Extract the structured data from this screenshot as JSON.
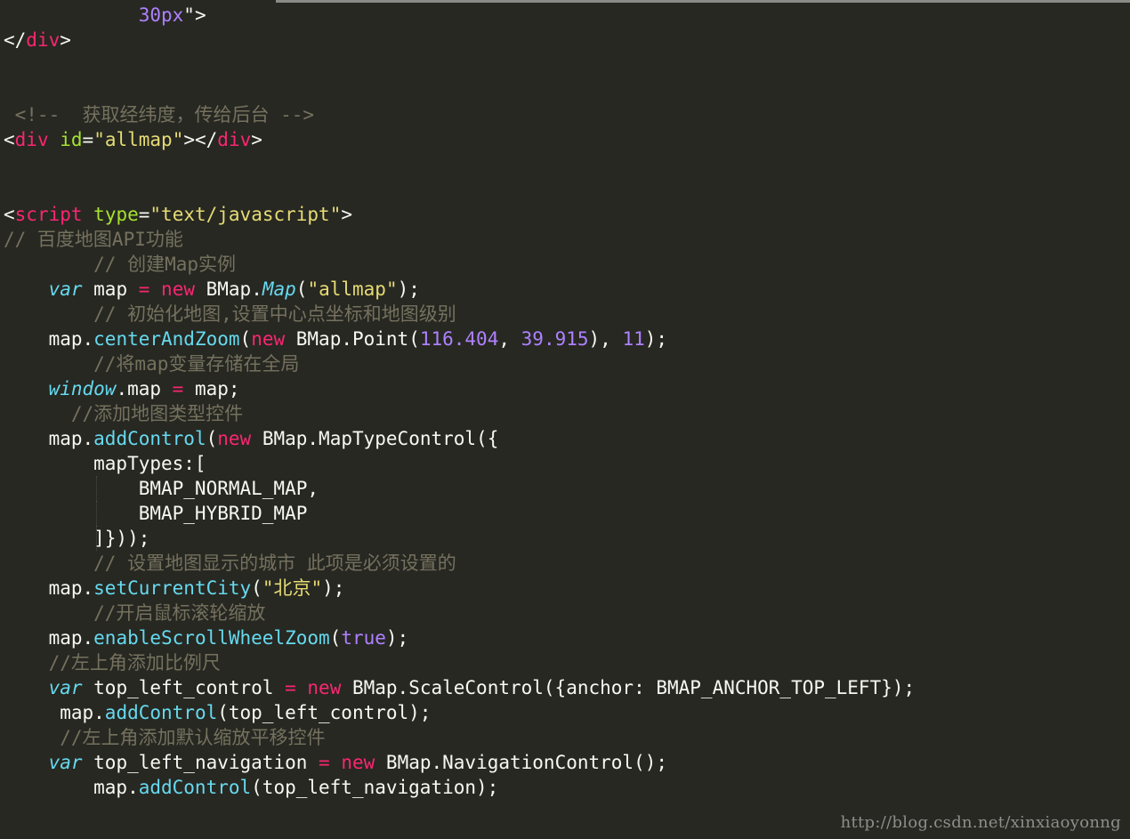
{
  "window": {
    "title": ""
  },
  "colors": {
    "background": "#272822",
    "tag": "#f92672",
    "attribute": "#a6e22e",
    "string": "#e6db74",
    "number": "#ae81ff",
    "type": "#66d9ef",
    "comment": "#75715e",
    "text": "#f8f8f2"
  },
  "editor": {
    "lines": [
      [
        {
          "t": "plain",
          "v": "            "
        },
        {
          "t": "num",
          "v": "30px"
        },
        {
          "t": "plain",
          "v": "\">"
        }
      ],
      [
        {
          "t": "plain",
          "v": "</"
        },
        {
          "t": "tag",
          "v": "div"
        },
        {
          "t": "plain",
          "v": ">"
        }
      ],
      [],
      [],
      [
        {
          "t": "com",
          "v": " <!--  获取经纬度，传给后台 -->"
        }
      ],
      [
        {
          "t": "plain",
          "v": "<"
        },
        {
          "t": "tag",
          "v": "div"
        },
        {
          "t": "plain",
          "v": " "
        },
        {
          "t": "attr",
          "v": "id"
        },
        {
          "t": "plain",
          "v": "="
        },
        {
          "t": "str",
          "v": "\"allmap\""
        },
        {
          "t": "plain",
          "v": "></"
        },
        {
          "t": "tag",
          "v": "div"
        },
        {
          "t": "plain",
          "v": ">"
        }
      ],
      [],
      [],
      [
        {
          "t": "plain",
          "v": "<"
        },
        {
          "t": "tag",
          "v": "script"
        },
        {
          "t": "plain",
          "v": " "
        },
        {
          "t": "attr",
          "v": "type"
        },
        {
          "t": "plain",
          "v": "="
        },
        {
          "t": "str",
          "v": "\"text/javascript\""
        },
        {
          "t": "plain",
          "v": ">"
        }
      ],
      [
        {
          "t": "com",
          "v": "// 百度地图API功能"
        }
      ],
      [
        {
          "t": "com",
          "v": "        // 创建Map实例"
        }
      ],
      [
        {
          "t": "plain",
          "v": "    "
        },
        {
          "t": "type",
          "v": "var"
        },
        {
          "t": "plain",
          "v": " map "
        },
        {
          "t": "kw",
          "v": "="
        },
        {
          "t": "plain",
          "v": " "
        },
        {
          "t": "kw",
          "v": "new"
        },
        {
          "t": "plain",
          "v": " BMap."
        },
        {
          "t": "type",
          "v": "Map"
        },
        {
          "t": "plain",
          "v": "("
        },
        {
          "t": "str",
          "v": "\"allmap\""
        },
        {
          "t": "plain",
          "v": ");"
        }
      ],
      [
        {
          "t": "com",
          "v": "        // 初始化地图,设置中心点坐标和地图级别"
        }
      ],
      [
        {
          "t": "plain",
          "v": "    map."
        },
        {
          "t": "fn",
          "v": "centerAndZoom"
        },
        {
          "t": "plain",
          "v": "("
        },
        {
          "t": "kw",
          "v": "new"
        },
        {
          "t": "plain",
          "v": " BMap.Point("
        },
        {
          "t": "num",
          "v": "116.404"
        },
        {
          "t": "plain",
          "v": ", "
        },
        {
          "t": "num",
          "v": "39.915"
        },
        {
          "t": "plain",
          "v": "), "
        },
        {
          "t": "num",
          "v": "11"
        },
        {
          "t": "plain",
          "v": ");"
        }
      ],
      [
        {
          "t": "com",
          "v": "        //将map变量存储在全局"
        }
      ],
      [
        {
          "t": "plain",
          "v": "    "
        },
        {
          "t": "type",
          "v": "window"
        },
        {
          "t": "plain",
          "v": ".map "
        },
        {
          "t": "kw",
          "v": "="
        },
        {
          "t": "plain",
          "v": " map;"
        }
      ],
      [
        {
          "t": "com",
          "v": "      //添加地图类型控件"
        }
      ],
      [
        {
          "t": "plain",
          "v": "    map."
        },
        {
          "t": "fn",
          "v": "addControl"
        },
        {
          "t": "plain",
          "v": "("
        },
        {
          "t": "kw",
          "v": "new"
        },
        {
          "t": "plain",
          "v": " BMap.MapTypeControl({"
        }
      ],
      [
        {
          "t": "plain",
          "v": "        mapTypes:["
        }
      ],
      [
        {
          "t": "plain",
          "v": "            BMAP_NORMAL_MAP,"
        }
      ],
      [
        {
          "t": "plain",
          "v": "            BMAP_HYBRID_MAP"
        }
      ],
      [
        {
          "t": "plain",
          "v": "        ]}));"
        }
      ],
      [
        {
          "t": "com",
          "v": "        // 设置地图显示的城市 此项是必须设置的"
        }
      ],
      [
        {
          "t": "plain",
          "v": "    map."
        },
        {
          "t": "fn",
          "v": "setCurrentCity"
        },
        {
          "t": "plain",
          "v": "("
        },
        {
          "t": "str",
          "v": "\"北京\""
        },
        {
          "t": "plain",
          "v": ");"
        }
      ],
      [
        {
          "t": "com",
          "v": "        //开启鼠标滚轮缩放"
        }
      ],
      [
        {
          "t": "plain",
          "v": "    map."
        },
        {
          "t": "fn",
          "v": "enableScrollWheelZoom"
        },
        {
          "t": "plain",
          "v": "("
        },
        {
          "t": "num",
          "v": "true"
        },
        {
          "t": "plain",
          "v": ");"
        }
      ],
      [
        {
          "t": "com",
          "v": "    //左上角添加比例尺"
        }
      ],
      [
        {
          "t": "plain",
          "v": "    "
        },
        {
          "t": "type",
          "v": "var"
        },
        {
          "t": "plain",
          "v": " top_left_control "
        },
        {
          "t": "kw",
          "v": "="
        },
        {
          "t": "plain",
          "v": " "
        },
        {
          "t": "kw",
          "v": "new"
        },
        {
          "t": "plain",
          "v": " BMap.ScaleControl({anchor: BMAP_ANCHOR_TOP_LEFT});"
        }
      ],
      [
        {
          "t": "plain",
          "v": "     map."
        },
        {
          "t": "fn",
          "v": "addControl"
        },
        {
          "t": "plain",
          "v": "(top_left_control);"
        }
      ],
      [
        {
          "t": "com",
          "v": "     //左上角添加默认缩放平移控件"
        }
      ],
      [
        {
          "t": "plain",
          "v": "    "
        },
        {
          "t": "type",
          "v": "var"
        },
        {
          "t": "plain",
          "v": " top_left_navigation "
        },
        {
          "t": "kw",
          "v": "="
        },
        {
          "t": "plain",
          "v": " "
        },
        {
          "t": "kw",
          "v": "new"
        },
        {
          "t": "plain",
          "v": " BMap.NavigationControl();"
        }
      ],
      [
        {
          "t": "plain",
          "v": "        map."
        },
        {
          "t": "fn",
          "v": "addControl"
        },
        {
          "t": "plain",
          "v": "(top_left_navigation);"
        }
      ]
    ]
  },
  "watermark": "http://blog.csdn.net/xinxiaoyonng"
}
